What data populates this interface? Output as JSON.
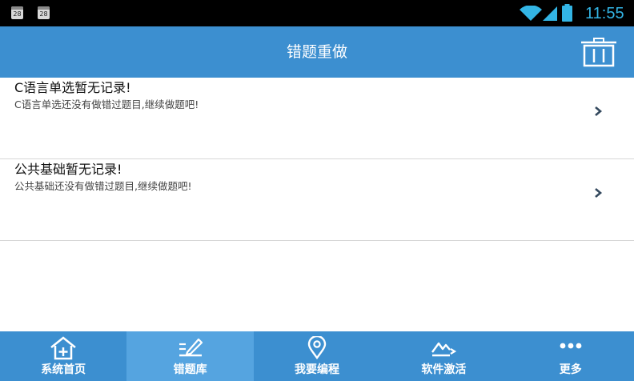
{
  "status_bar": {
    "calendar_day_1": "28",
    "calendar_day_2": "28",
    "time": "11:55",
    "icons": [
      "calendar-icon",
      "calendar-icon",
      "wifi-icon",
      "signal-icon",
      "battery-icon"
    ]
  },
  "header": {
    "title": "错题重做",
    "action_icon": "trash-icon"
  },
  "list": {
    "items": [
      {
        "title": "C语言单选暂无记录!",
        "description": "C语言单选还没有做错过题目,继续做题吧!"
      },
      {
        "title": "公共基础暂无记录!",
        "description": "公共基础还没有做错过题目,继续做题吧!"
      }
    ]
  },
  "bottom_nav": {
    "active_index": 1,
    "tabs": [
      {
        "label": "系统首页",
        "icon": "home-plus-icon"
      },
      {
        "label": "错题库",
        "icon": "edit-pencil-icon"
      },
      {
        "label": "我要编程",
        "icon": "location-pin-icon"
      },
      {
        "label": "软件激活",
        "icon": "mountain-key-icon"
      },
      {
        "label": "更多",
        "icon": "more-dots-icon"
      }
    ]
  },
  "colors": {
    "primary": "#3c8fd0",
    "active_tab": "#55a4e0",
    "status_accent": "#33b5e5"
  }
}
